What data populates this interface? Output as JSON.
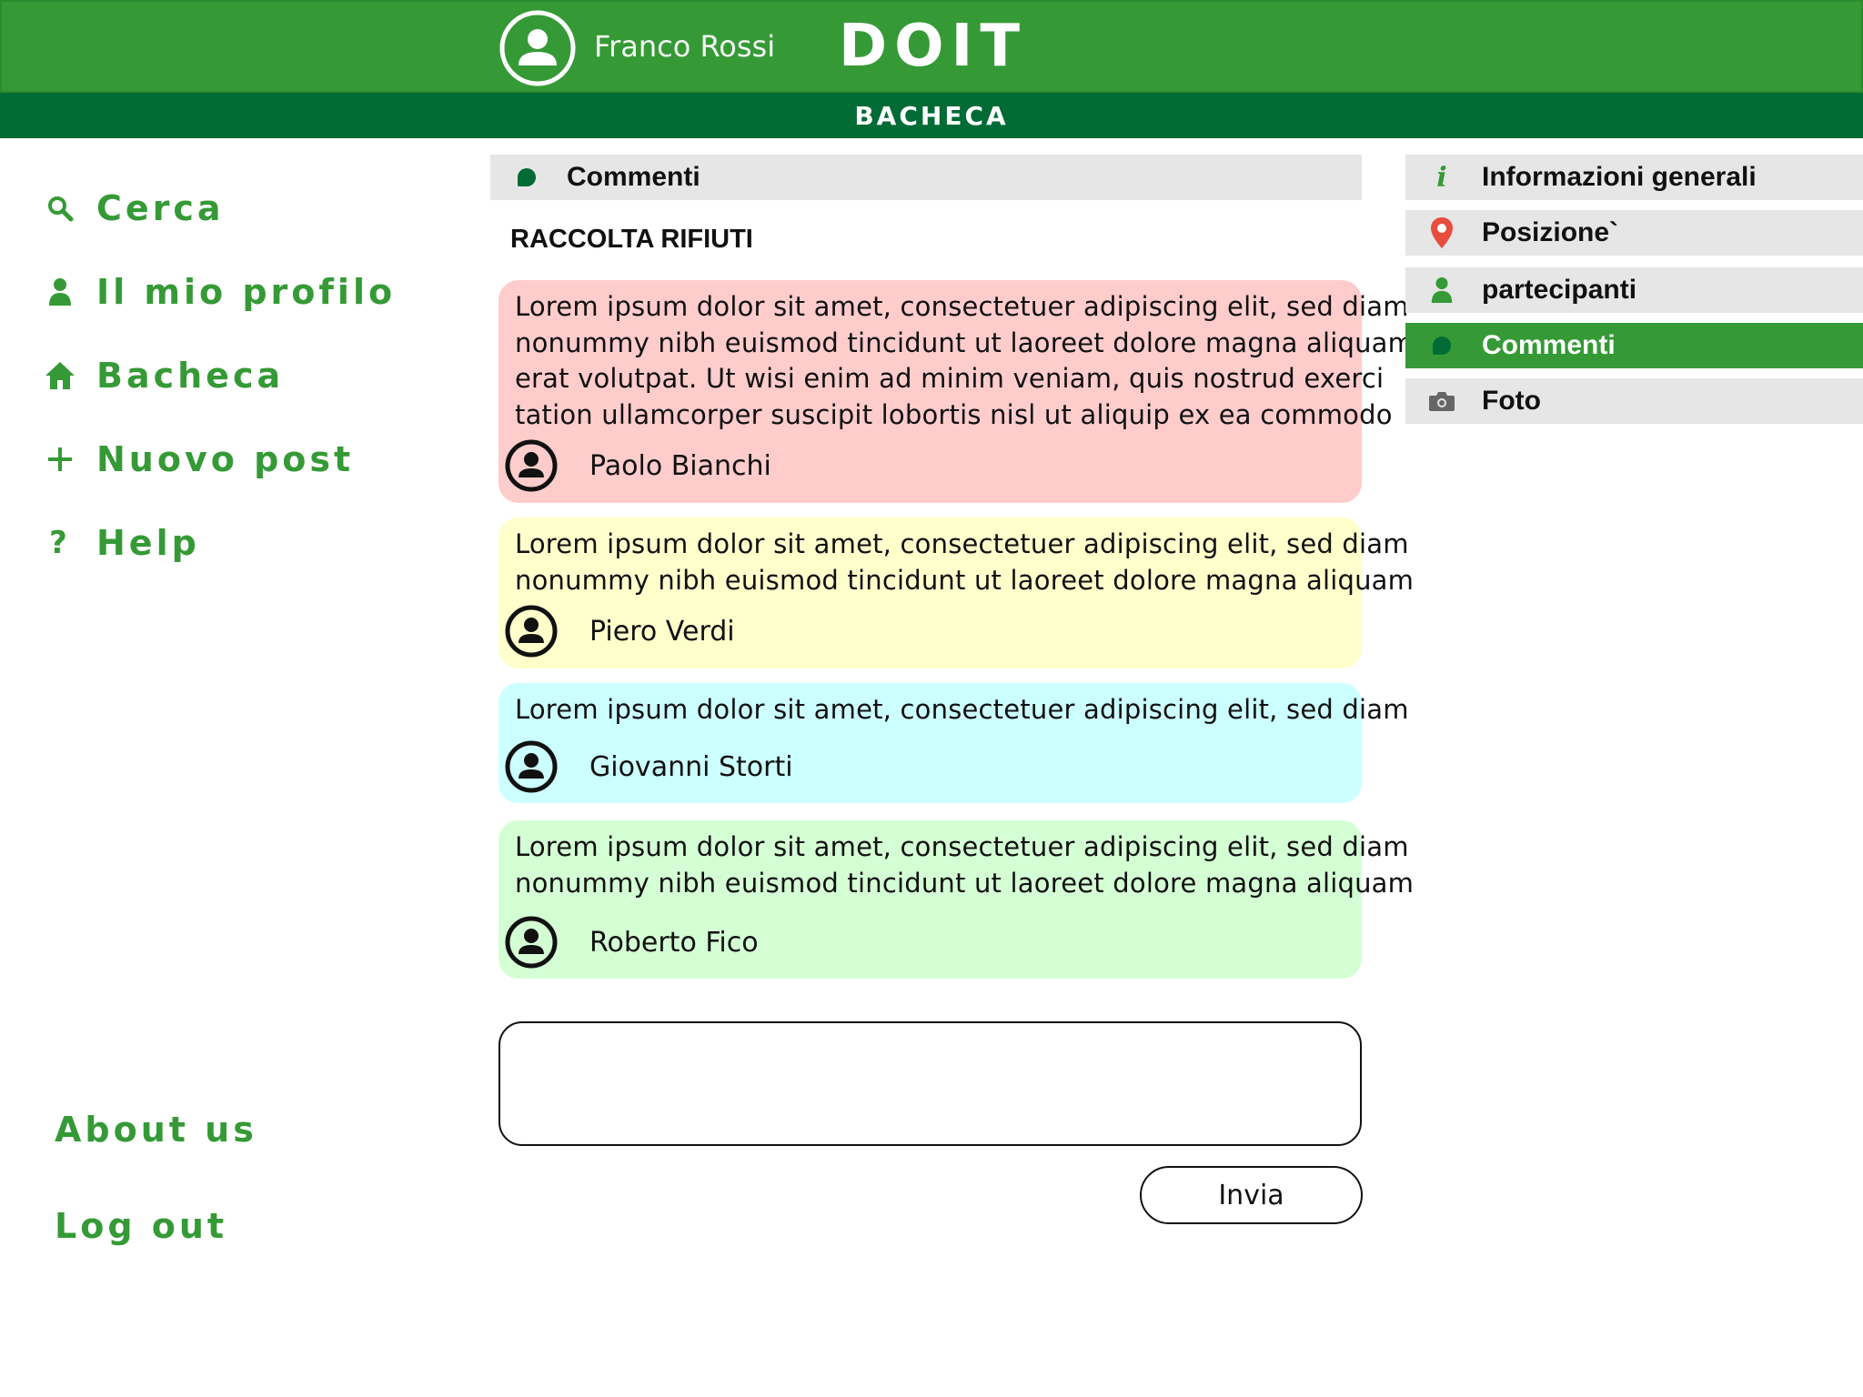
{
  "header": {
    "user_name": "Franco Rossi",
    "app_title": "DOIT",
    "section_title": "BACHECA"
  },
  "sidebar": {
    "items": [
      {
        "label": "Cerca",
        "icon": "search-icon"
      },
      {
        "label": "Il mio profilo",
        "icon": "user-icon"
      },
      {
        "label": "Bacheca",
        "icon": "home-icon"
      },
      {
        "label": "Nuovo post",
        "icon": "plus-icon"
      },
      {
        "label": "Help",
        "icon": "help-icon"
      }
    ],
    "about_label": "About us",
    "logout_label": "Log out"
  },
  "main": {
    "section_label": "Commenti",
    "post_title": "RACCOLTA RIFIUTI",
    "comments": [
      {
        "lines": [
          "Lorem ipsum dolor sit amet, consectetuer adipiscing elit, sed diam",
          "nonummy nibh euismod tincidunt ut laoreet dolore magna aliquam",
          "erat volutpat. Ut wisi enim ad minim veniam, quis nostrud exerci",
          "tation ullamcorper suscipit lobortis nisl ut aliquip ex ea commodo"
        ],
        "author": "Paolo Bianchi",
        "color": "#ffcccc"
      },
      {
        "lines": [
          "Lorem ipsum dolor sit amet, consectetuer adipiscing elit, sed diam",
          "nonummy nibh euismod tincidunt ut laoreet dolore magna aliquam"
        ],
        "author": "Piero Verdi",
        "color": "#ffffcc"
      },
      {
        "lines": [
          "Lorem ipsum dolor sit amet, consectetuer adipiscing elit, sed diam"
        ],
        "author": "Giovanni Storti",
        "color": "#ccffff"
      },
      {
        "lines": [
          "Lorem ipsum dolor sit amet, consectetuer adipiscing elit, sed diam",
          "nonummy nibh euismod tincidunt ut laoreet dolore magna aliquam"
        ],
        "author": "Roberto Fico",
        "color": "#d4ffd4"
      }
    ],
    "reply_placeholder": "",
    "send_label": "Invia"
  },
  "right_menu": {
    "items": [
      {
        "label": "Informazioni generali",
        "icon": "info-icon",
        "active": false
      },
      {
        "label": "Posizione`",
        "icon": "location-pin-icon",
        "active": false
      },
      {
        "label": "partecipanti",
        "icon": "user-icon",
        "active": false
      },
      {
        "label": "Commenti",
        "icon": "comment-icon",
        "active": true
      },
      {
        "label": "Foto",
        "icon": "camera-icon",
        "active": false
      }
    ]
  },
  "colors": {
    "primary_green": "#359a36",
    "dark_green": "#006b35",
    "panel_gray": "#e6e6e6",
    "pin_red": "#e74c3c"
  }
}
